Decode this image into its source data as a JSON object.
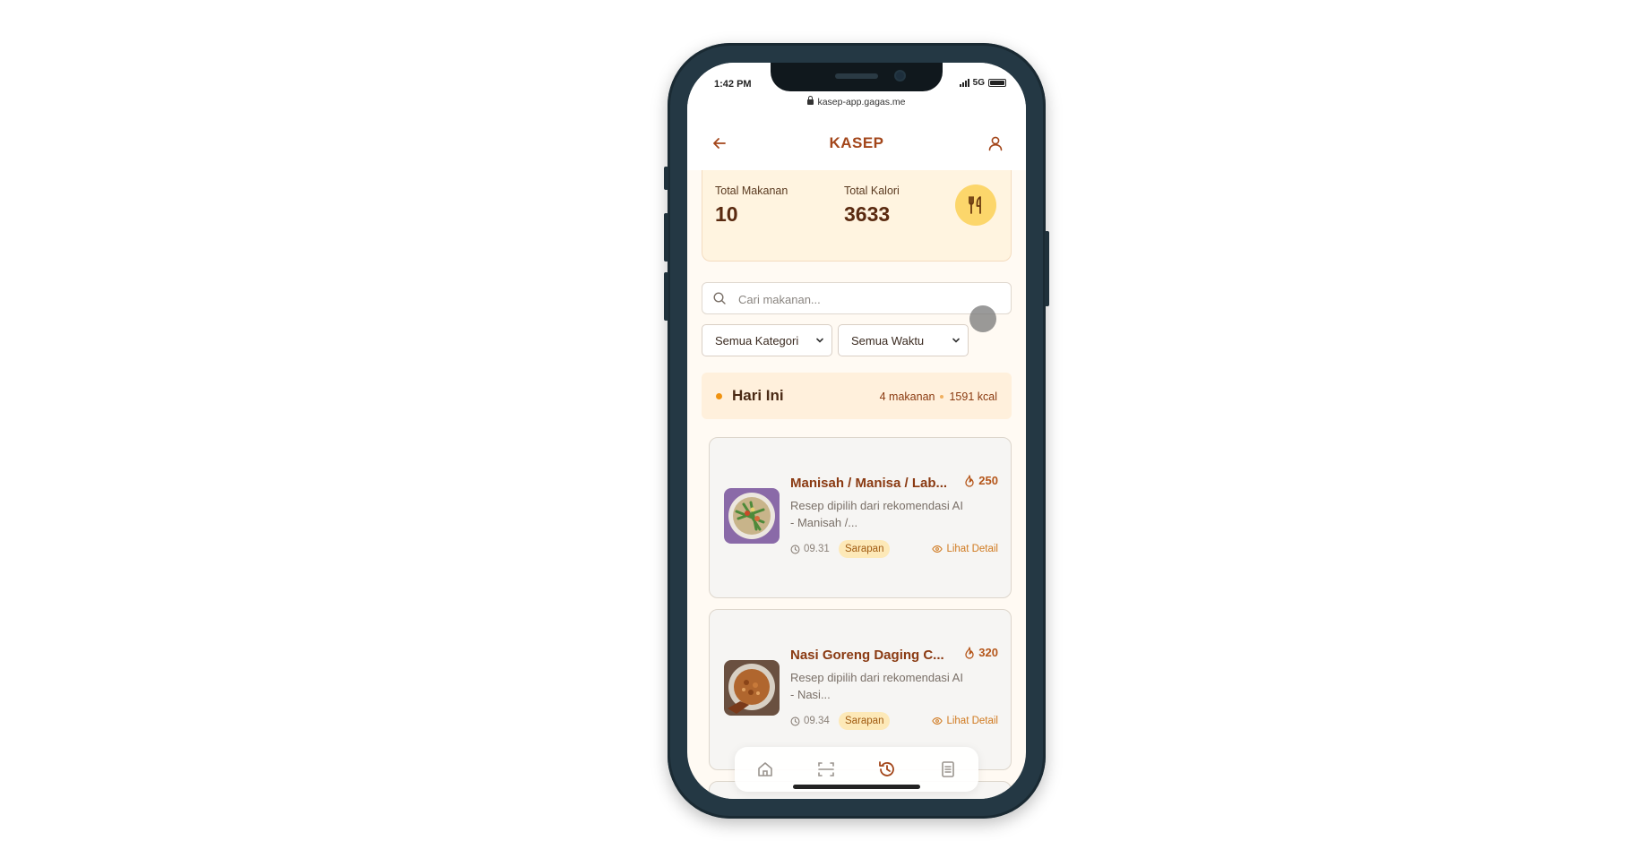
{
  "status": {
    "time": "1:42 PM",
    "network": "5G"
  },
  "browser": {
    "url": "kasep-app.gagas.me"
  },
  "header": {
    "title": "KASEP"
  },
  "summary": {
    "total_food_label": "Total Makanan",
    "total_food_value": "10",
    "total_cal_label": "Total Kalori",
    "total_cal_value": "3633"
  },
  "search": {
    "placeholder": "Cari makanan..."
  },
  "filters": {
    "category": "Semua Kategori",
    "time": "Semua Waktu"
  },
  "group": {
    "title": "Hari Ini",
    "count": "4 makanan",
    "kcal": "1591 kcal"
  },
  "meals": [
    {
      "name": "Manisah / Manisa / Lab...",
      "calories": "250",
      "desc": "Resep dipilih dari rekomendasi AI - Manisah /...",
      "time": "09.31",
      "category": "Sarapan",
      "detail_label": "Lihat Detail"
    },
    {
      "name": "Nasi Goreng Daging C...",
      "calories": "320",
      "desc": "Resep dipilih dari rekomendasi AI - Nasi...",
      "time": "09.34",
      "category": "Sarapan",
      "detail_label": "Lihat Detail"
    }
  ],
  "nav": {
    "icons": [
      "home-icon",
      "scan-icon",
      "history-icon",
      "notes-icon"
    ]
  },
  "colors": {
    "accent": "#a3461a",
    "summary_bg": "#fff4e0",
    "badge_bg": "#fde9b8"
  }
}
